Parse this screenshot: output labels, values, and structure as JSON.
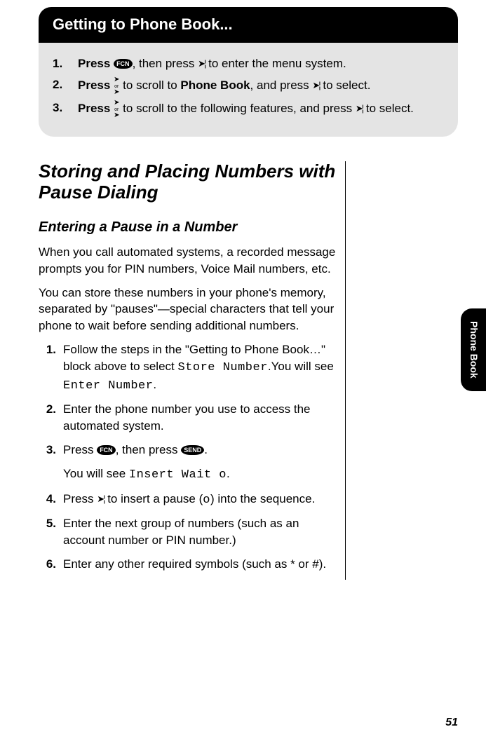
{
  "banner": "Getting to Phone Book...",
  "box_steps": {
    "s1_press": "Press",
    "s1_fcn": "FCN",
    "s1_mid": ", then press ",
    "s1_end": " to enter the menu system.",
    "s2_press": "Press",
    "s2_mid": " to scroll to ",
    "s2_bold": "Phone Book",
    "s2_mid2": ", and press ",
    "s2_end": " to select.",
    "s3_press": "Press",
    "s3_mid": " to scroll to the following features, and press ",
    "s3_end": " to select."
  },
  "section_title": "Storing and Placing Numbers with Pause Dialing",
  "sub_title": "Entering a Pause in a Number",
  "para1": "When you call automated systems, a recorded message prompts you for PIN numbers, Voice Mail numbers, etc.",
  "para2": "You can store these numbers in your phone's memory, separated by \"pauses\"—special characters that tell your phone to wait before sending additional numbers.",
  "body_steps": {
    "s1a": "Follow the steps in the \"Getting to Phone Book…\" block above to select ",
    "s1_lcd1": "Store Number",
    "s1b": ".You will see ",
    "s1_lcd2": "Enter Number",
    "s1c": ".",
    "s2": "Enter the phone number you use to access the automated system.",
    "s3a": "Press ",
    "s3_fcn": "FCN",
    "s3b": ", then press ",
    "s3_send": "SEND",
    "s3c": ".",
    "s3_sub_a": "You will see ",
    "s3_sub_lcd": "Insert Wait o",
    "s3_sub_b": ".",
    "s4a": "Press ",
    "s4b": " to insert a pause (",
    "s4_lcd": "o",
    "s4c": ") into the sequence.",
    "s5": "Enter the next group of numbers (such as an account number or PIN number.)",
    "s6": "Enter any other required symbols (such as * or #)."
  },
  "side_tab": "Phone Book",
  "page_num": "51",
  "nums": {
    "n1": "1.",
    "n2": "2.",
    "n3": "3.",
    "n4": "4.",
    "n5": "5.",
    "n6": "6."
  }
}
